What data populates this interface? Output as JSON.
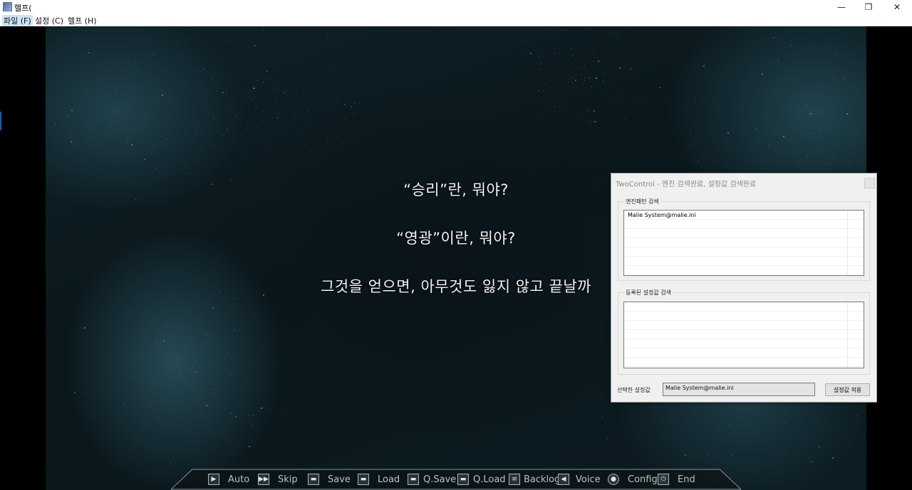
{
  "window": {
    "title": "헬프(",
    "controls": {
      "minimize": "—",
      "maximize": "❐",
      "close": "✕"
    }
  },
  "menu": [
    {
      "label": "파일 (F)"
    },
    {
      "label": "설정 (C)"
    },
    {
      "label": "헬프 (H)"
    }
  ],
  "dialogue": [
    "“승리”란, 뭐야?",
    "“영광”이란, 뭐야?",
    "그것을 얻으면, 아무것도 잃지 않고 끝날까"
  ],
  "controls": [
    {
      "label": "Auto",
      "icon": "play-icon",
      "glyph": "▶"
    },
    {
      "label": "Skip",
      "icon": "fast-forward-icon",
      "glyph": "▶▶"
    },
    {
      "label": "Save",
      "icon": "save-icon",
      "glyph": "▬"
    },
    {
      "label": "Load",
      "icon": "load-icon",
      "glyph": "▬"
    },
    {
      "label": "Q.Save",
      "icon": "quick-save-icon",
      "glyph": "▬"
    },
    {
      "label": "Q.Load",
      "icon": "quick-load-icon",
      "glyph": "▬"
    },
    {
      "label": "Backlog",
      "icon": "backlog-icon",
      "glyph": "≡"
    },
    {
      "label": "Voice",
      "icon": "speaker-icon",
      "glyph": "◀"
    },
    {
      "label": "Config",
      "icon": "gear-icon",
      "glyph": "●"
    },
    {
      "label": "End",
      "icon": "power-icon",
      "glyph": "⏻"
    }
  ],
  "twocontrol": {
    "title": "TwoControl - 엔진 검색완료, 설정값 검색완료",
    "engine_group_label": "엔진패턴 검색",
    "engine_results": [
      "Malie System@malie.ini"
    ],
    "registered_group_label": "등록된 설정값 검색",
    "registered_results": [],
    "selected_label": "선택한 설정값",
    "selected_value": "Malie System@malie.ini",
    "apply_button": "설정값 적용"
  },
  "colors": {
    "scene_dark": "#0a171c",
    "scene_glow": "#4a8c9c",
    "dialog_bg": "#f0f0f0",
    "menu_highlight": "#cce4f7"
  }
}
